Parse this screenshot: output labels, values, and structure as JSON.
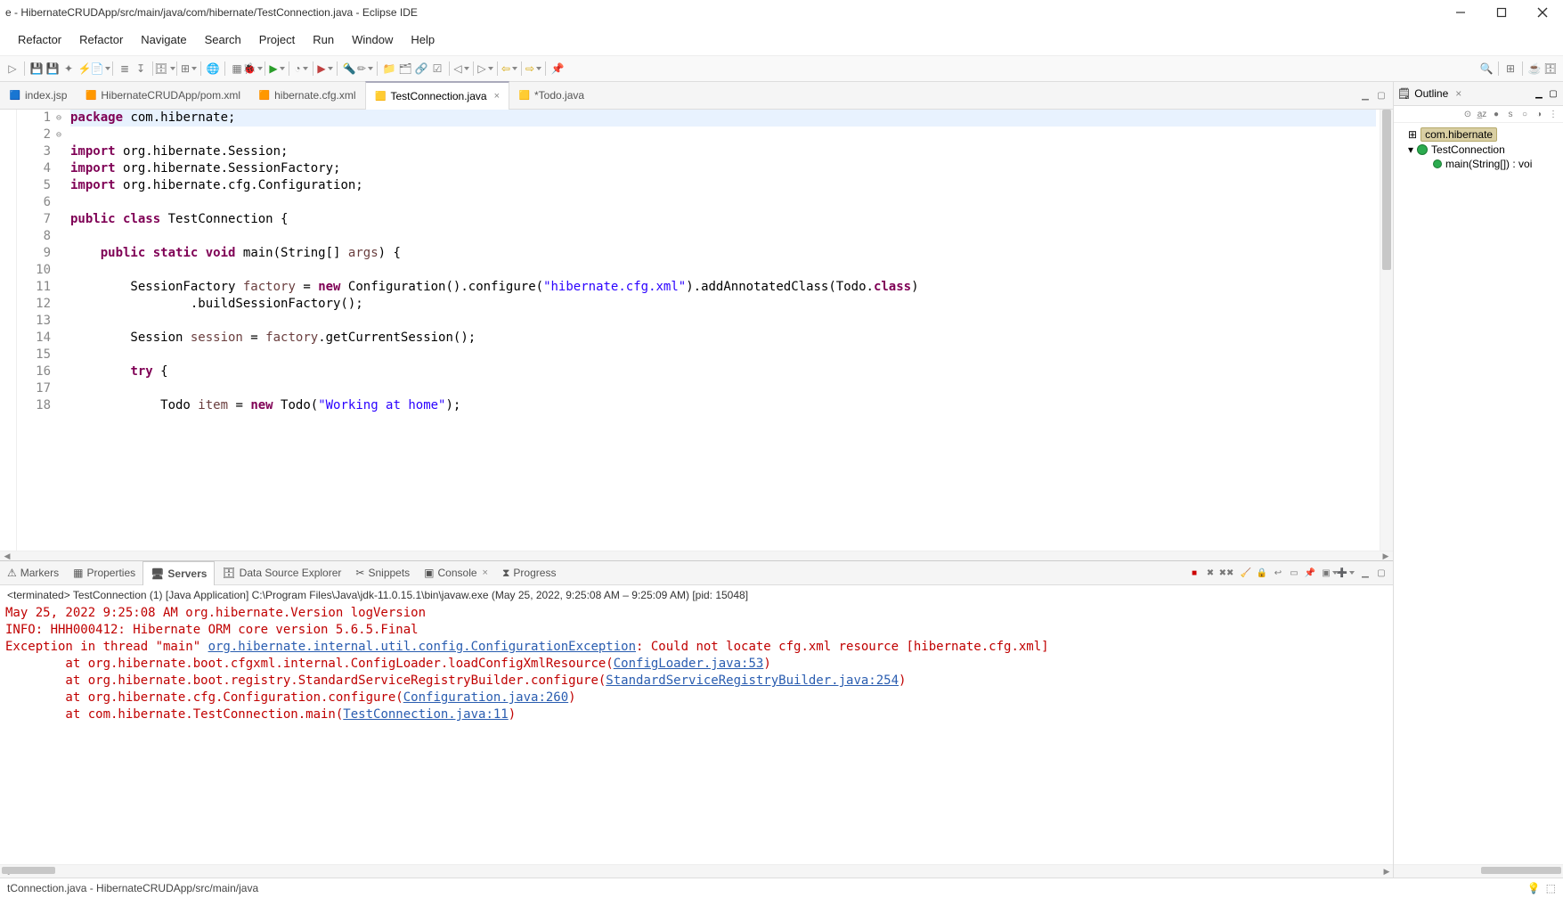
{
  "title": "e - HibernateCRUDApp/src/main/java/com/hibernate/TestConnection.java - Eclipse IDE",
  "menubar": [
    "Refactor",
    "Refactor",
    "Navigate",
    "Search",
    "Project",
    "Run",
    "Window",
    "Help"
  ],
  "editor_tabs": [
    {
      "label": "index.jsp",
      "icon": "jsp"
    },
    {
      "label": "HibernateCRUDApp/pom.xml",
      "icon": "xml"
    },
    {
      "label": "hibernate.cfg.xml",
      "icon": "xml"
    },
    {
      "label": "TestConnection.java",
      "icon": "java",
      "active": true,
      "closable": true
    },
    {
      "label": "*Todo.java",
      "icon": "java"
    }
  ],
  "code_lines": [
    {
      "n": 1,
      "hl": true,
      "tokens": [
        [
          "kw",
          "package"
        ],
        [
          "",
          " com.hibernate;"
        ]
      ]
    },
    {
      "n": 2,
      "tokens": []
    },
    {
      "n": 3,
      "fold": "⊖",
      "tokens": [
        [
          "kw",
          "import"
        ],
        [
          "",
          " org.hibernate.Session;"
        ]
      ]
    },
    {
      "n": 4,
      "tokens": [
        [
          "kw",
          "import"
        ],
        [
          "",
          " org.hibernate.SessionFactory;"
        ]
      ]
    },
    {
      "n": 5,
      "tokens": [
        [
          "kw",
          "import"
        ],
        [
          "",
          " org.hibernate.cfg.Configuration;"
        ]
      ]
    },
    {
      "n": 6,
      "tokens": []
    },
    {
      "n": 7,
      "tokens": [
        [
          "kw",
          "public"
        ],
        [
          "",
          " "
        ],
        [
          "kw",
          "class"
        ],
        [
          "",
          " TestConnection {"
        ]
      ]
    },
    {
      "n": 8,
      "tokens": []
    },
    {
      "n": 9,
      "fold": "⊖",
      "tokens": [
        [
          "",
          "    "
        ],
        [
          "kw",
          "public"
        ],
        [
          "",
          " "
        ],
        [
          "kw",
          "static"
        ],
        [
          "",
          " "
        ],
        [
          "kw",
          "void"
        ],
        [
          "",
          " main(String[] "
        ],
        [
          "fld",
          "args"
        ],
        [
          "",
          ") {"
        ]
      ]
    },
    {
      "n": 10,
      "tokens": []
    },
    {
      "n": 11,
      "tokens": [
        [
          "",
          "        SessionFactory "
        ],
        [
          "fld",
          "factory"
        ],
        [
          "",
          " = "
        ],
        [
          "kw",
          "new"
        ],
        [
          "",
          " Configuration().configure("
        ],
        [
          "str",
          "\"hibernate.cfg.xml\""
        ],
        [
          "",
          ").addAnnotatedClass(Todo."
        ],
        [
          "kw",
          "class"
        ],
        [
          "",
          ")"
        ]
      ]
    },
    {
      "n": 12,
      "tokens": [
        [
          "",
          "                .buildSessionFactory();"
        ]
      ]
    },
    {
      "n": 13,
      "tokens": []
    },
    {
      "n": 14,
      "tokens": [
        [
          "",
          "        Session "
        ],
        [
          "fld",
          "session"
        ],
        [
          "",
          " = "
        ],
        [
          "fld",
          "factory"
        ],
        [
          "",
          ".getCurrentSession();"
        ]
      ]
    },
    {
      "n": 15,
      "tokens": []
    },
    {
      "n": 16,
      "tokens": [
        [
          "",
          "        "
        ],
        [
          "kw",
          "try"
        ],
        [
          "",
          " {"
        ]
      ]
    },
    {
      "n": 17,
      "tokens": []
    },
    {
      "n": 18,
      "tokens": [
        [
          "",
          "            Todo "
        ],
        [
          "fld",
          "item"
        ],
        [
          "",
          " = "
        ],
        [
          "kw",
          "new"
        ],
        [
          "",
          " Todo("
        ],
        [
          "str",
          "\"Working at home\""
        ],
        [
          "",
          ");"
        ]
      ]
    }
  ],
  "bottom_tabs": [
    {
      "label": "Markers",
      "icon": "markers"
    },
    {
      "label": "Properties",
      "icon": "properties"
    },
    {
      "label": "Servers",
      "icon": "servers",
      "active": true
    },
    {
      "label": "Data Source Explorer",
      "icon": "dse"
    },
    {
      "label": "Snippets",
      "icon": "snippets"
    },
    {
      "label": "Console",
      "icon": "console",
      "closable": true
    },
    {
      "label": "Progress",
      "icon": "progress"
    }
  ],
  "console_meta": "<terminated> TestConnection (1) [Java Application] C:\\Program Files\\Java\\jdk-11.0.15.1\\bin\\javaw.exe  (May 25, 2022, 9:25:08 AM – 9:25:09 AM) [pid: 15048]",
  "console_lines": [
    {
      "cls": "c-red",
      "text": "May 25, 2022 9:25:08 AM org.hibernate.Version logVersion"
    },
    {
      "cls": "c-red",
      "text": "INFO: HHH000412: Hibernate ORM core version 5.6.5.Final"
    },
    {
      "cls": "c-red",
      "parts": [
        [
          "",
          "Exception in thread \"main\" "
        ],
        [
          "link",
          "org.hibernate.internal.util.config.ConfigurationException"
        ],
        [
          "",
          ": Could not locate cfg.xml resource [hibernate.cfg.xml]"
        ]
      ]
    },
    {
      "cls": "c-red",
      "parts": [
        [
          "",
          "        at org.hibernate.boot.cfgxml.internal.ConfigLoader.loadConfigXmlResource("
        ],
        [
          "link",
          "ConfigLoader.java:53"
        ],
        [
          "",
          ")"
        ]
      ]
    },
    {
      "cls": "c-red",
      "parts": [
        [
          "",
          "        at org.hibernate.boot.registry.StandardServiceRegistryBuilder.configure("
        ],
        [
          "link",
          "StandardServiceRegistryBuilder.java:254"
        ],
        [
          "",
          ")"
        ]
      ]
    },
    {
      "cls": "c-red",
      "parts": [
        [
          "",
          "        at org.hibernate.cfg.Configuration.configure("
        ],
        [
          "link",
          "Configuration.java:260"
        ],
        [
          "",
          ")"
        ]
      ]
    },
    {
      "cls": "c-red",
      "parts": [
        [
          "",
          "        at com.hibernate.TestConnection.main("
        ],
        [
          "link",
          "TestConnection.java:11"
        ],
        [
          "",
          ")"
        ]
      ]
    }
  ],
  "outline": {
    "title": "Outline",
    "package": "com.hibernate",
    "class": "TestConnection",
    "method": "main(String[]) : voi"
  },
  "statusbar": "tConnection.java - HibernateCRUDApp/src/main/java"
}
